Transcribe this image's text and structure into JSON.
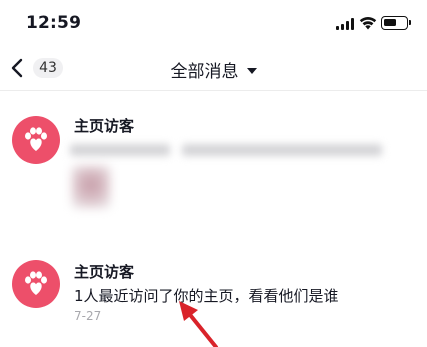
{
  "status_bar": {
    "time": "12:59"
  },
  "nav": {
    "unread_count": "43",
    "title": "全部消息"
  },
  "messages": [
    {
      "title": "主页访客",
      "text": "",
      "time": "",
      "blurred": true,
      "icon": "paw-heart-icon"
    },
    {
      "title": "主页访客",
      "text": "1人最近访问了你的主页，看看他们是谁",
      "time": "7-27",
      "blurred": false,
      "icon": "paw-heart-icon"
    }
  ],
  "colors": {
    "avatar": "#ed4f6a",
    "arrow": "#d9232a",
    "muted_text": "#a8a8ad"
  }
}
